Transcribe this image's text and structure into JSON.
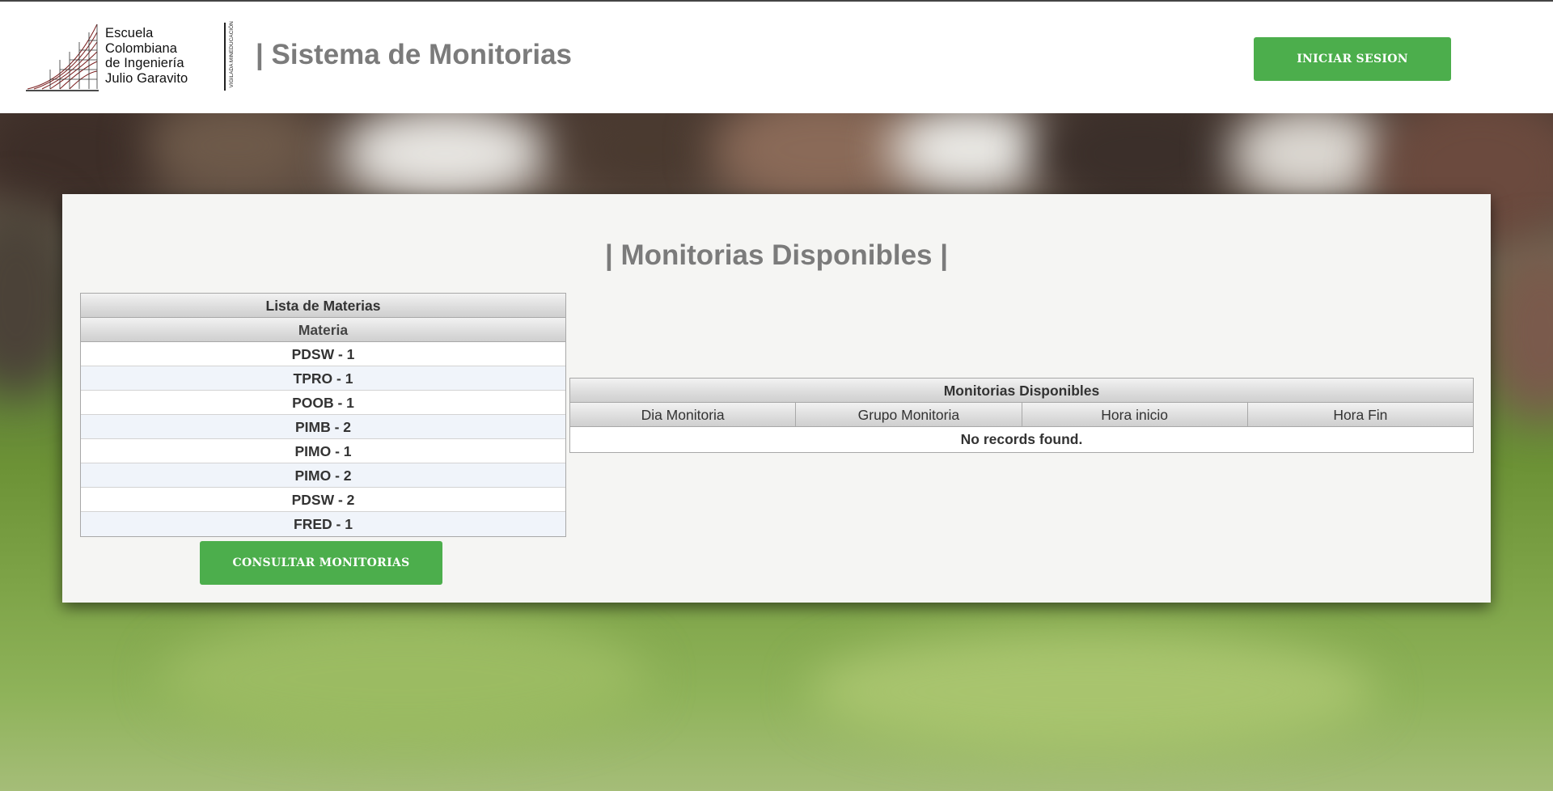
{
  "header": {
    "logo_lines": [
      "Escuela",
      "Colombiana",
      "de Ingeniería",
      "Julio Garavito"
    ],
    "logo_vertical_text": "VIGILADA MINEDUCACIÓN",
    "app_title": "| Sistema de Monitorias",
    "login_button": "INICIAR SESION"
  },
  "main": {
    "title": "| Monitorias Disponibles |",
    "materias_table": {
      "caption": "Lista de Materias",
      "column": "Materia",
      "rows": [
        "PDSW - 1",
        "TPRO - 1",
        "POOB - 1",
        "PIMB - 2",
        "PIMO - 1",
        "PIMO - 2",
        "PDSW - 2",
        "FRED - 1"
      ]
    },
    "consult_button": "CONSULTAR MONITORIAS",
    "monitorias_table": {
      "caption": "Monitorias Disponibles",
      "columns": [
        "Dia Monitoria",
        "Grupo Monitoria",
        "Hora inicio",
        "Hora Fin"
      ],
      "empty_message": "No records found."
    }
  },
  "colors": {
    "accent_green": "#4cae4c",
    "title_gray": "#7b7b7b",
    "panel_bg": "#f5f5f3"
  }
}
